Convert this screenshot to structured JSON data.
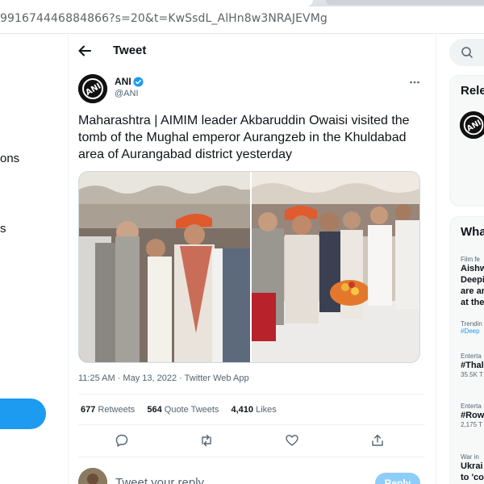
{
  "browser": {
    "url": "991674446884866?s=20&t=KwSsdL_AlHn8w3NRAJEVMg"
  },
  "left_nav": {
    "fragments": [
      "ons",
      "s"
    ]
  },
  "header": {
    "title": "Tweet"
  },
  "tweet": {
    "author_name": "ANI",
    "author_handle": "@ANI",
    "avatar_text": "ANI",
    "text": "Maharashtra | AIMIM leader Akbaruddin Owaisi visited the tomb of the Mughal emperor Aurangzeb in the Khuldabad area of Aurangabad district yesterday",
    "timestamp": "11:25 AM · May 13, 2022 · Twitter Web App",
    "retweets_count": "677",
    "retweets_label": "Retweets",
    "quotes_count": "564",
    "quotes_label": "Quote Tweets",
    "likes_count": "4,410",
    "likes_label": "Likes"
  },
  "reply": {
    "placeholder": "Tweet your reply",
    "button_label": "Reply"
  },
  "sidebar": {
    "relevant_title": "Rele",
    "whats_title": "Wha",
    "trends": [
      {
        "context": "Film fe",
        "lines": [
          "Aishw",
          "Deepi",
          "are ar",
          "at the"
        ],
        "link": ""
      },
      {
        "context": "Trendin",
        "lines": [],
        "link": "#Deep"
      },
      {
        "context": "Enterta",
        "lines": [
          "#Thal"
        ],
        "link": "",
        "count": "35.5K T"
      },
      {
        "context": "Enterta",
        "lines": [
          "#Row"
        ],
        "link": "",
        "count": "2,175 T"
      },
      {
        "context": "War in",
        "lines": [
          "Ukrai",
          "to 'co"
        ],
        "link": ""
      }
    ]
  },
  "colors": {
    "accent": "#1d9bf0",
    "text_secondary": "#536471",
    "divider": "#eff3f4"
  },
  "icons": [
    "back-arrow-icon",
    "verified-badge-icon",
    "more-icon",
    "reply-icon",
    "retweet-icon",
    "like-icon",
    "share-icon",
    "search-icon"
  ]
}
